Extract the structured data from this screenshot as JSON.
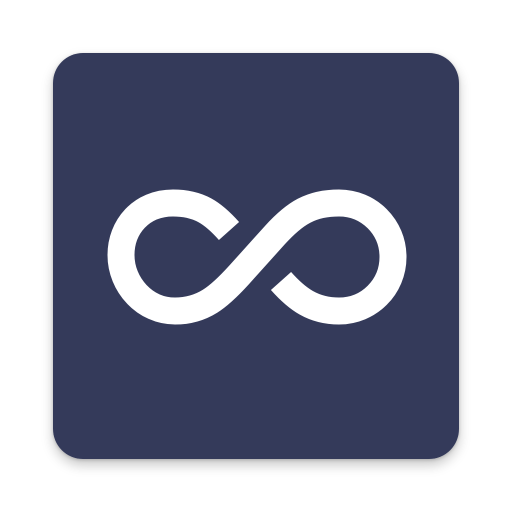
{
  "icon": {
    "name": "infinity-icon",
    "background_color": "#343a5a",
    "glyph_color": "#ffffff"
  }
}
